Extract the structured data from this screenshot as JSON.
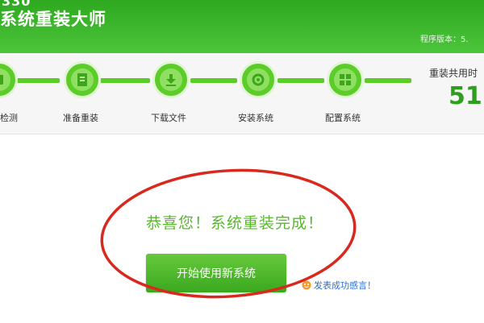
{
  "header": {
    "logo_fragment": "330",
    "app_title": "系统重装大师",
    "version_label": "程序版本：5."
  },
  "steps": [
    {
      "label": "检测",
      "icon": "check-icon"
    },
    {
      "label": "准备重装",
      "icon": "document-icon"
    },
    {
      "label": "下载文件",
      "icon": "download-icon"
    },
    {
      "label": "安装系统",
      "icon": "gear-install-icon"
    },
    {
      "label": "配置系统",
      "icon": "windows-icon"
    }
  ],
  "timer": {
    "label": "重装共用时",
    "value": "51"
  },
  "main": {
    "success_message": "恭喜您！系统重装完成！",
    "start_button": "开始使用新系统",
    "feedback_link": "发表成功感言！"
  },
  "colors": {
    "header_green": "#3cb62b",
    "step_green": "#5ccc28",
    "annotation_red": "#d9281e",
    "link_blue": "#2f6fd0"
  }
}
